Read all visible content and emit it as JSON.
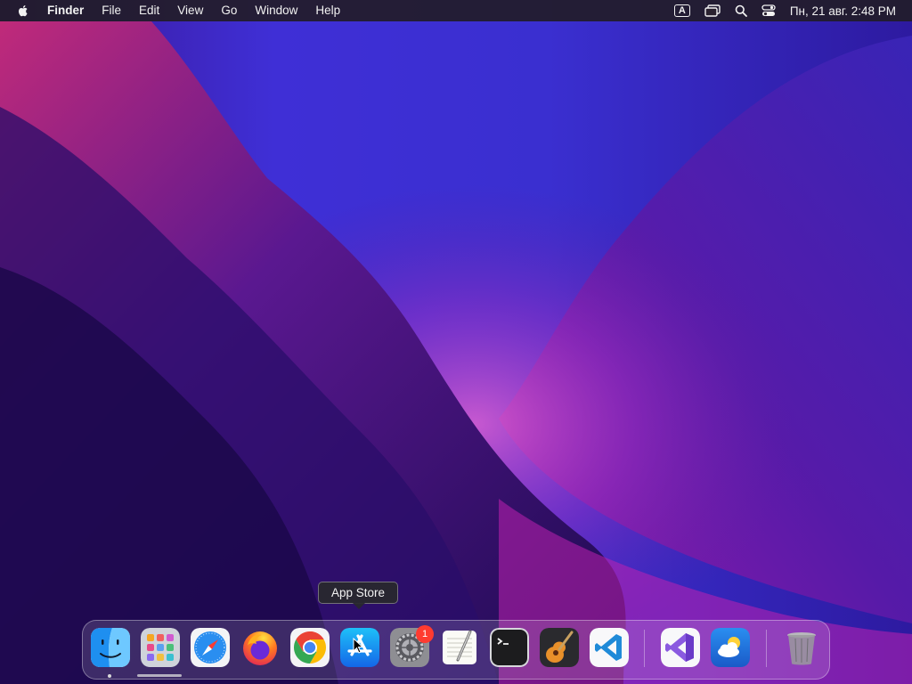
{
  "menubar": {
    "app_name": "Finder",
    "menus": [
      "File",
      "Edit",
      "View",
      "Go",
      "Window",
      "Help"
    ],
    "input_source": "A",
    "clock": "Пн, 21 авг. 2:48 PM"
  },
  "tooltip": {
    "label": "App Store"
  },
  "dock": {
    "apps": [
      {
        "icon": "finder-icon",
        "running": true
      },
      {
        "icon": "launchpad-icon"
      },
      {
        "icon": "safari-icon"
      },
      {
        "icon": "firefox-icon"
      },
      {
        "icon": "chrome-icon"
      },
      {
        "icon": "app-store-icon",
        "hovered": true
      },
      {
        "icon": "system-preferences-icon",
        "badge": "1"
      },
      {
        "icon": "textedit-icon"
      },
      {
        "icon": "terminal-icon"
      },
      {
        "icon": "garageband-icon"
      },
      {
        "icon": "vscode-icon"
      },
      {
        "icon": "visual-studio-icon"
      },
      {
        "icon": "weather-icon"
      },
      {
        "icon": "trash-icon"
      }
    ],
    "badge_count": "1"
  },
  "colors": {
    "wallpaper_dark": "#1a0a4a",
    "wallpaper_magenta": "#a0208a",
    "wallpaper_blue": "#3a3ad8",
    "menubar_bg": "#221c28",
    "badge_red": "#ff3b30"
  }
}
